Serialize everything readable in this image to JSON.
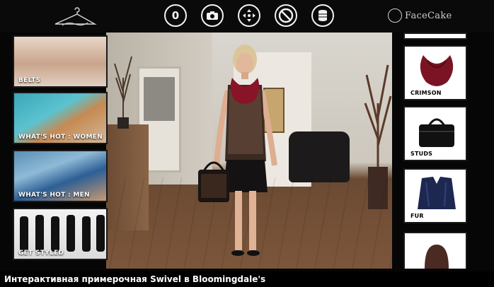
{
  "top_bar": {
    "brand_text": "FaceCake",
    "toolbar": [
      {
        "name": "counter",
        "icon": "zero-counter",
        "value": "0"
      },
      {
        "name": "camera",
        "icon": "camera-icon"
      },
      {
        "name": "move",
        "icon": "move-arrows-icon"
      },
      {
        "name": "clear",
        "icon": "prohibited-icon"
      },
      {
        "name": "stack",
        "icon": "stack-icon"
      }
    ]
  },
  "left_rail": {
    "categories": [
      {
        "label": "BELTS"
      },
      {
        "label": "WHAT'S HOT : WOMEN"
      },
      {
        "label": "WHAT'S HOT : MEN"
      },
      {
        "label": "GET STYLED"
      }
    ]
  },
  "right_rail": {
    "products": [
      {
        "label": "CRIMSON",
        "icon": "scarf-icon",
        "color": "#7a1425"
      },
      {
        "label": "STUDS",
        "icon": "handbag-icon",
        "color": "#111111"
      },
      {
        "label": "FUR",
        "icon": "fur-vest-icon",
        "color": "#1d2850"
      },
      {
        "label": "",
        "icon": "hat-icon",
        "color": "#4a2a22"
      }
    ]
  },
  "caption": "Интерактивная примерочная Swivel в Bloomingdale's",
  "colors": {
    "background": "#060606",
    "icon_stroke": "#f2f2f2",
    "scarf": "#8a1427"
  }
}
